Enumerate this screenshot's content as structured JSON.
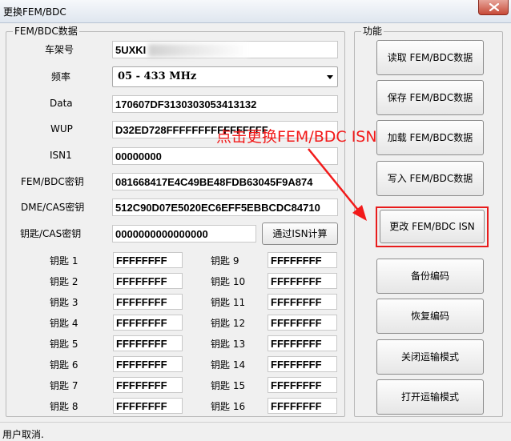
{
  "window": {
    "title": "更换FEM/BDC"
  },
  "fem_group": {
    "legend": "FEM/BDC数据",
    "vin": {
      "label": "车架号",
      "value": "5UXKI"
    },
    "frequency": {
      "label": "频率",
      "value": "05 - 433 MHz"
    },
    "data": {
      "label": "Data",
      "value": "170607DF3130303053413132"
    },
    "wup": {
      "label": "WUP",
      "value": "D32ED728FFFFFFFFFFFFFFFF"
    },
    "isn1": {
      "label": "ISN1",
      "value": "00000000"
    },
    "fem_key": {
      "label": "FEM/BDC密钥",
      "value": "081668417E4C49BE48FDB63045F9A874"
    },
    "dme_key": {
      "label": "DME/CAS密钥",
      "value": "512C90D07E5020EC6EFF5EBBCDC84710"
    },
    "key_cas": {
      "label": "钥匙/CAS密钥",
      "value": "0000000000000000",
      "button": "通过ISN计算"
    },
    "keys": [
      {
        "label": "钥匙 1",
        "value": "FFFFFFFF"
      },
      {
        "label": "钥匙 2",
        "value": "FFFFFFFF"
      },
      {
        "label": "钥匙 3",
        "value": "FFFFFFFF"
      },
      {
        "label": "钥匙 4",
        "value": "FFFFFFFF"
      },
      {
        "label": "钥匙 5",
        "value": "FFFFFFFF"
      },
      {
        "label": "钥匙 6",
        "value": "FFFFFFFF"
      },
      {
        "label": "钥匙 7",
        "value": "FFFFFFFF"
      },
      {
        "label": "钥匙 8",
        "value": "FFFFFFFF"
      },
      {
        "label": "钥匙 9",
        "value": "FFFFFFFF"
      },
      {
        "label": "钥匙 10",
        "value": "FFFFFFFF"
      },
      {
        "label": "钥匙 11",
        "value": "FFFFFFFF"
      },
      {
        "label": "钥匙 12",
        "value": "FFFFFFFF"
      },
      {
        "label": "钥匙 13",
        "value": "FFFFFFFF"
      },
      {
        "label": "钥匙 14",
        "value": "FFFFFFFF"
      },
      {
        "label": "钥匙 15",
        "value": "FFFFFFFF"
      },
      {
        "label": "钥匙 16",
        "value": "FFFFFFFF"
      }
    ]
  },
  "functions": {
    "legend": "功能",
    "buttons": [
      "读取 FEM/BDC数据",
      "保存 FEM/BDC数据",
      "加载 FEM/BDC数据",
      "写入 FEM/BDC数据",
      "更改 FEM/BDC ISN",
      "备份编码",
      "恢复编码",
      "关闭运输模式",
      "打开运输模式"
    ]
  },
  "annotation": {
    "text": "点击更换FEM/BDC  ISN",
    "color": "#f21a1a"
  },
  "status": {
    "text": "用户取消."
  }
}
